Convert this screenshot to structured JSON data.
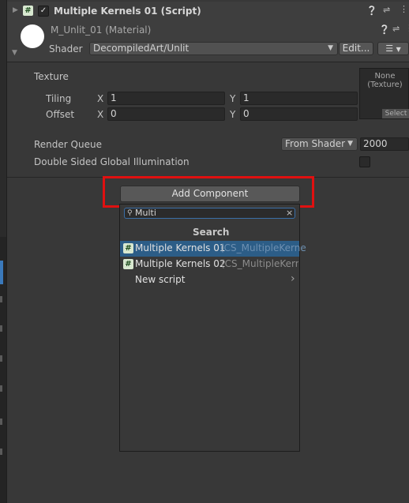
{
  "script_component": {
    "title": "Multiple Kernels 01 (Script)",
    "enabled_check": "✓",
    "icons": [
      "help-icon",
      "presets-icon",
      "more-icon"
    ]
  },
  "material": {
    "name": "M_Unlit_01 (Material)",
    "shader_label": "Shader",
    "shader_value": "DecompiledArt/Unlit",
    "edit_button": "Edit...",
    "list_button": "☰"
  },
  "properties": {
    "texture_label": "Texture",
    "tiling_label": "Tiling",
    "offset_label": "Offset",
    "x_label": "X",
    "y_label": "Y",
    "tiling_x": "1",
    "tiling_y": "1",
    "offset_x": "0",
    "offset_y": "0",
    "texture_none": "None",
    "texture_type": "(Texture)",
    "texture_select": "Select",
    "render_queue_label": "Render Queue",
    "render_queue_mode": "From Shader",
    "render_queue_value": "2000",
    "double_sided_gi_label": "Double Sided Global Illumination",
    "double_sided_gi_checked": false
  },
  "add_component": {
    "button_label": "Add Component",
    "search_value": "Multi",
    "search_clear": "×",
    "popup_title": "Search",
    "results": [
      {
        "name": "Multiple Kernels 01",
        "script": "(CS_MultipleKerne",
        "selected": true
      },
      {
        "name": "Multiple Kernels 02",
        "script": "(CS_MultipleKerne",
        "selected": false
      }
    ],
    "new_script_label": "New script",
    "new_script_arrow": "›"
  }
}
